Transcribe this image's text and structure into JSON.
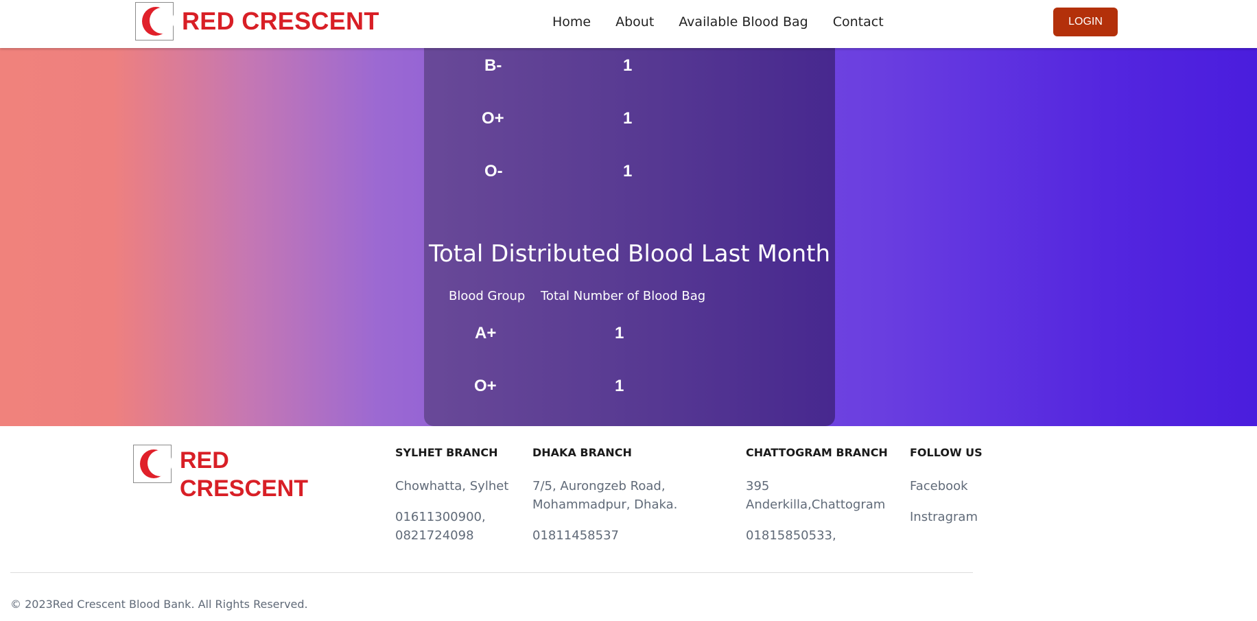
{
  "navbar": {
    "brand": "RED CRESCENT",
    "links": [
      "Home",
      "About",
      "Available Blood Bag",
      "Contact"
    ],
    "login_label": "LOGIN"
  },
  "available_partial": [
    {
      "group": "B-",
      "count": "1"
    },
    {
      "group": "O+",
      "count": "1"
    },
    {
      "group": "O-",
      "count": "1"
    }
  ],
  "distributed": {
    "title": "Total Distributed Blood Last Month",
    "headers": [
      "Blood Group",
      "Total Number of Blood Bag"
    ],
    "rows": [
      {
        "group": "A+",
        "count": "1"
      },
      {
        "group": "O+",
        "count": "1"
      }
    ]
  },
  "footer": {
    "brand_line1": "RED",
    "brand_line2": "CRESCENT",
    "sylhet": {
      "heading": "SYLHET BRANCH",
      "address": "Chowhatta, Sylhet",
      "phone1": "01611300900,",
      "phone2": "0821724098"
    },
    "dhaka": {
      "heading": "DHAKA BRANCH",
      "address1": "7/5, Aurongzeb Road,",
      "address2": "Mohammadpur, Dhaka.",
      "phone": "01811458537"
    },
    "chattogram": {
      "heading": "CHATTOGRAM BRANCH",
      "address1": "395",
      "address2": "Anderkilla,Chattogram",
      "phone": "01815850533,"
    },
    "follow": {
      "heading": "FOLLOW US",
      "links": [
        "Facebook",
        "Instragram"
      ]
    },
    "copyright": "© 2023Red Crescent Blood Bank. All Rights Reserved."
  },
  "colors": {
    "brand_red": "#d81f26",
    "login_button": "#b3300a",
    "panel": "#5a3c93"
  }
}
